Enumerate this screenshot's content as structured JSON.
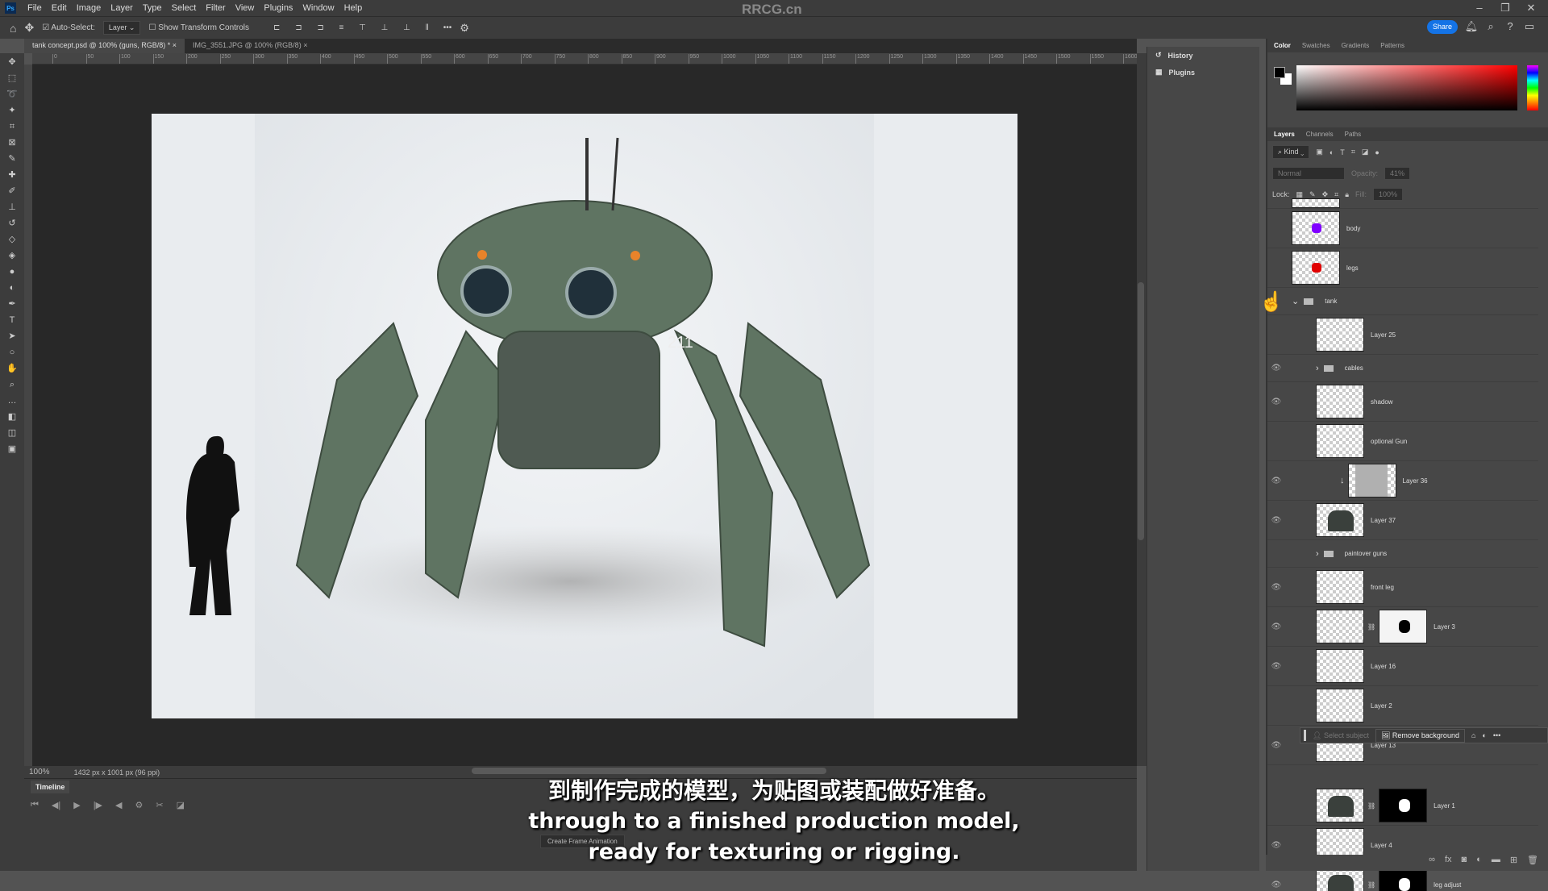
{
  "app": {
    "logo": "Ps",
    "watermark": "RRCG.cn",
    "menu": [
      "File",
      "Edit",
      "Image",
      "Layer",
      "Type",
      "Select",
      "Filter",
      "View",
      "Plugins",
      "Window",
      "Help"
    ]
  },
  "options": {
    "auto_select_label": "Auto-Select:",
    "auto_select_checked": true,
    "target": "Layer",
    "show_transform_label": "Show Transform Controls",
    "share_label": "Share"
  },
  "tabs": [
    {
      "label": "tank concept.psd @ 100% (guns, RGB/8) *",
      "active": true
    },
    {
      "label": "IMG_3551.JPG @ 100% (RGB/8)",
      "active": false
    }
  ],
  "ruler": [
    "0",
    "50",
    "100",
    "150",
    "200",
    "250",
    "300",
    "350",
    "400",
    "450",
    "500",
    "550",
    "600",
    "650",
    "700",
    "750",
    "800",
    "850",
    "900",
    "950",
    "1000",
    "1050",
    "1100",
    "1150",
    "1200",
    "1250",
    "1300",
    "1350",
    "1400",
    "1450",
    "1500",
    "1550",
    "1600"
  ],
  "status": {
    "zoom": "100%",
    "doc_info": "1432 px x 1001 px (96 ppi)"
  },
  "timeline": {
    "tab": "Timeline",
    "create_button": "Create Frame Animation"
  },
  "history_col": {
    "items": [
      "History",
      "Plugins"
    ]
  },
  "color_panel": {
    "tabs": [
      "Color",
      "Swatches",
      "Gradients",
      "Patterns"
    ],
    "foreground": "#000000",
    "background": "#ffffff",
    "hue": "#ff0000"
  },
  "layers_panel": {
    "tabs": [
      "Layers",
      "Channels",
      "Paths"
    ],
    "filter": "Kind",
    "blend": "Normal",
    "opacity_label": "Opacity:",
    "opacity": "41%",
    "lock_label": "Lock:",
    "fill_label": "Fill:",
    "fill": "100%",
    "layers": [
      {
        "name": "",
        "type": "layer",
        "visible": false,
        "indent": 0,
        "partial": true
      },
      {
        "name": "body",
        "type": "layer",
        "visible": false,
        "indent": 0,
        "thumb": "#8000ff"
      },
      {
        "name": "legs",
        "type": "layer",
        "visible": false,
        "indent": 0,
        "thumb": "#e00000"
      },
      {
        "name": "tank",
        "type": "group",
        "visible": false,
        "indent": 0,
        "open": true
      },
      {
        "name": "Layer 25",
        "type": "layer",
        "visible": false,
        "indent": 1
      },
      {
        "name": "cables",
        "type": "group",
        "visible": true,
        "indent": 1,
        "open": false
      },
      {
        "name": "shadow",
        "type": "layer",
        "visible": true,
        "indent": 1
      },
      {
        "name": "optional Gun",
        "type": "layer",
        "visible": false,
        "indent": 1
      },
      {
        "name": "Layer 36",
        "type": "layer",
        "visible": true,
        "indent": 2,
        "clipped": true,
        "thumb": "#b0b0b0"
      },
      {
        "name": "Layer 37",
        "type": "layer",
        "visible": true,
        "indent": 1,
        "thumb": "robot"
      },
      {
        "name": "paintover guns",
        "type": "group",
        "visible": false,
        "indent": 1,
        "open": false
      },
      {
        "name": "front leg",
        "type": "layer",
        "visible": true,
        "indent": 1
      },
      {
        "name": "Layer 3",
        "type": "layer",
        "visible": true,
        "indent": 1,
        "mask": "white"
      },
      {
        "name": "Layer 16",
        "type": "layer",
        "visible": true,
        "indent": 1
      },
      {
        "name": "Layer 2",
        "type": "layer",
        "visible": false,
        "indent": 1
      },
      {
        "name": "Layer 13",
        "type": "layer",
        "visible": true,
        "indent": 1
      },
      {
        "name": "Layer 1",
        "type": "layer",
        "visible": false,
        "indent": 1,
        "mask": "black",
        "thumb": "robot"
      },
      {
        "name": "Layer 4",
        "type": "layer",
        "visible": true,
        "indent": 1
      },
      {
        "name": "leg adjust",
        "type": "layer",
        "visible": true,
        "indent": 1,
        "mask": "black",
        "thumb": "robot"
      }
    ]
  },
  "context_bar": {
    "select_subject": "Select subject",
    "remove_background": "Remove background"
  },
  "canvas": {
    "robot_label": "211"
  },
  "subtitles": {
    "zh": "到制作完成的模型，为贴图或装配做好准备。",
    "en1": "through to a finished production model,",
    "en2": "ready for texturing or rigging."
  }
}
